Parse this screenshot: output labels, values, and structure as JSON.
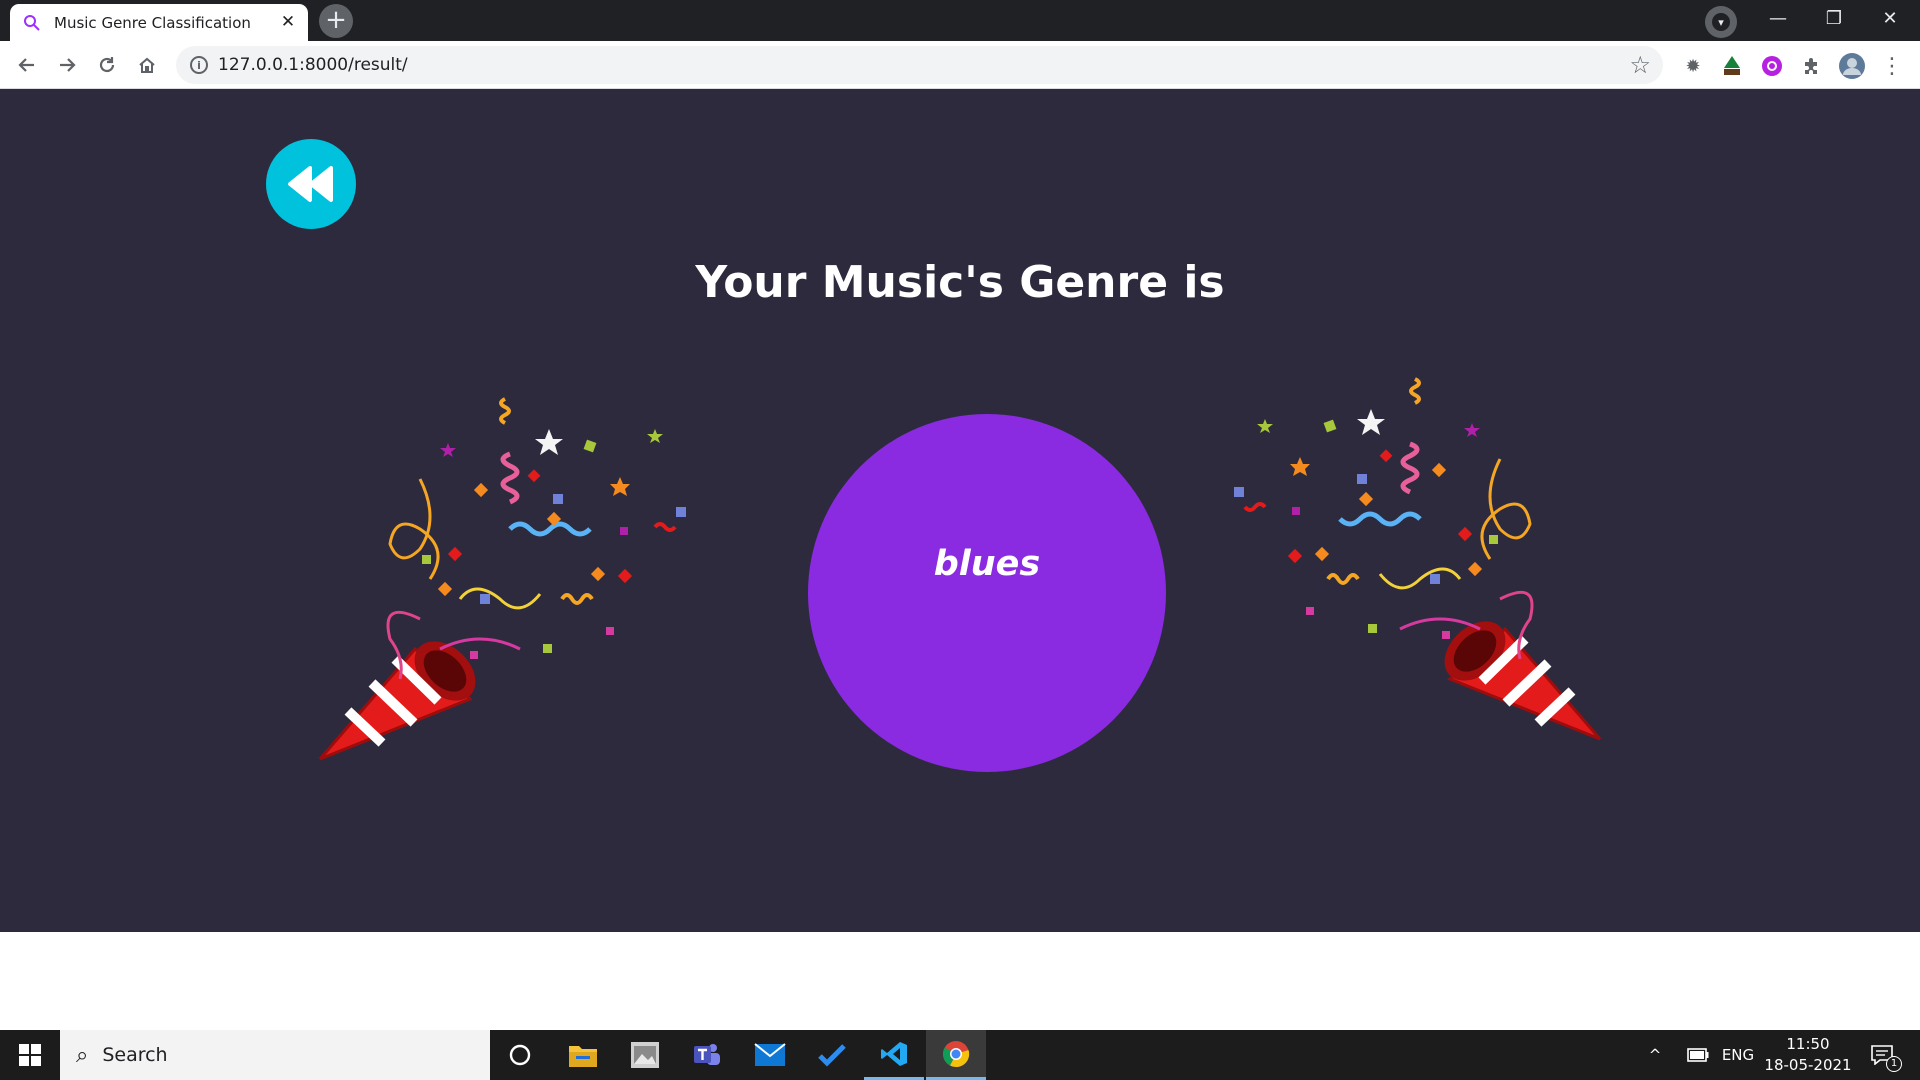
{
  "browser": {
    "tab_title": "Music Genre Classification",
    "url": "127.0.0.1:8000/result/"
  },
  "page": {
    "headline": "Your Music's Genre is",
    "genre": "blues",
    "colors": {
      "background": "#2e2a3e",
      "back_button": "#00c2dc",
      "genre_circle": "#8a2be2"
    }
  },
  "taskbar": {
    "search_placeholder": "Search",
    "language": "ENG",
    "time": "11:50",
    "date": "18-05-2021",
    "notification_count": "1",
    "apps": [
      "cortana-icon",
      "file-explorer-icon",
      "photos-icon",
      "teams-icon",
      "mail-icon",
      "todo-icon",
      "vscode-icon",
      "chrome-icon"
    ]
  }
}
